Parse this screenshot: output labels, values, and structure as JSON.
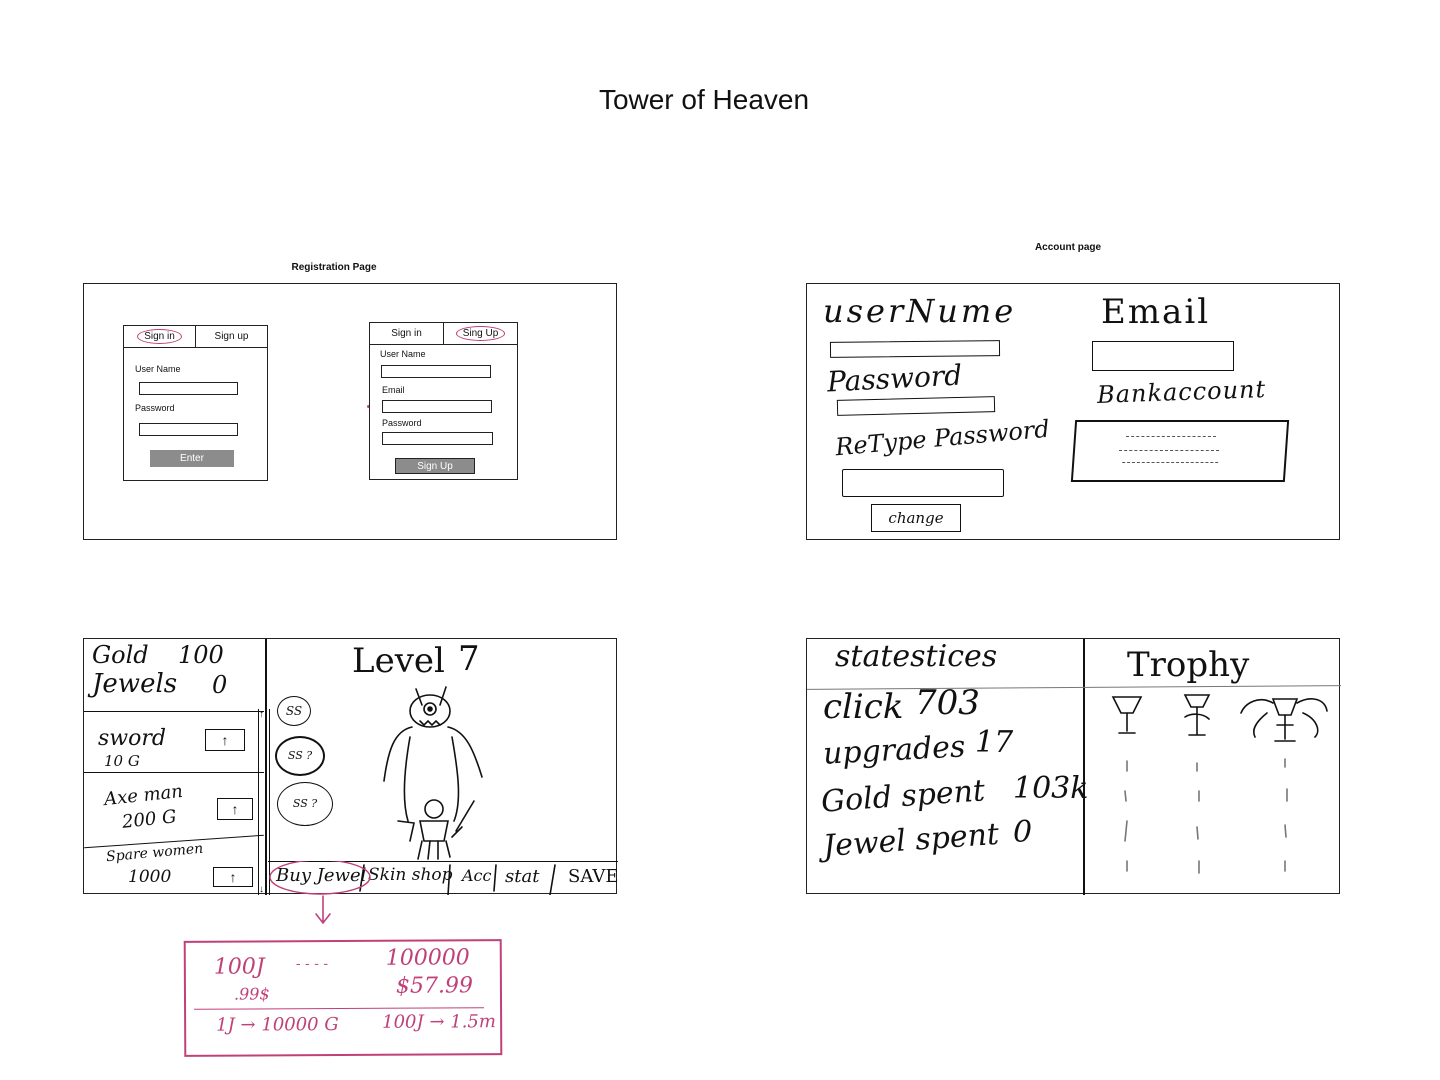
{
  "title": "Tower of Heaven",
  "registration": {
    "caption": "Registration Page",
    "signin_card": {
      "tab_signin": "Sign in",
      "tab_signup": "Sign up",
      "username_label": "User Name",
      "password_label": "Password",
      "enter_button": "Enter"
    },
    "signup_card": {
      "tab_signin": "Sign in",
      "tab_signup": "Sing Up",
      "username_label": "User Name",
      "email_label": "Email",
      "password_label": "Password",
      "signup_button": "Sign Up"
    }
  },
  "account": {
    "caption": "Account page",
    "username_label": "userNume",
    "password_label": "Password",
    "retype_label": "ReType Password",
    "email_label": "Email",
    "bank_label": "Bankaccount",
    "change_button": "change"
  },
  "game": {
    "gold_label": "Gold",
    "gold_value": "100",
    "jewels_label": "Jewels",
    "jewels_value": "0",
    "upgrades": [
      {
        "name": "sword",
        "cost": "10 G"
      },
      {
        "name": "Axe man",
        "cost": "200 G"
      },
      {
        "name": "Spare women",
        "cost": "1000"
      }
    ],
    "skill_bubbles": [
      "SS",
      "SS ?",
      "SS ?"
    ],
    "level_label": "Level",
    "level_value": "7",
    "bottom_tabs": [
      "Buy Jewel",
      "Skin shop",
      "Acc",
      "stat",
      "SAVE"
    ]
  },
  "jewel_popup": {
    "top_left": "100J",
    "top_left_price": ".99$",
    "top_dots": "- - - -",
    "top_right": "100000",
    "top_right_price": "$57.99",
    "bottom_left": "1J → 10000 G",
    "bottom_right": "100J → 1.5m"
  },
  "stats": {
    "header": "statestices",
    "trophy_header": "Trophy",
    "lines": [
      {
        "label": "click",
        "value": "703"
      },
      {
        "label": "upgrades",
        "value": "17"
      },
      {
        "label": "Gold spent",
        "value": "103k"
      },
      {
        "label": "Jewel spent",
        "value": "0"
      }
    ]
  },
  "colors": {
    "accent_pink": "#c0407a",
    "button_gray": "#8c8c8c",
    "ink": "#111111"
  }
}
